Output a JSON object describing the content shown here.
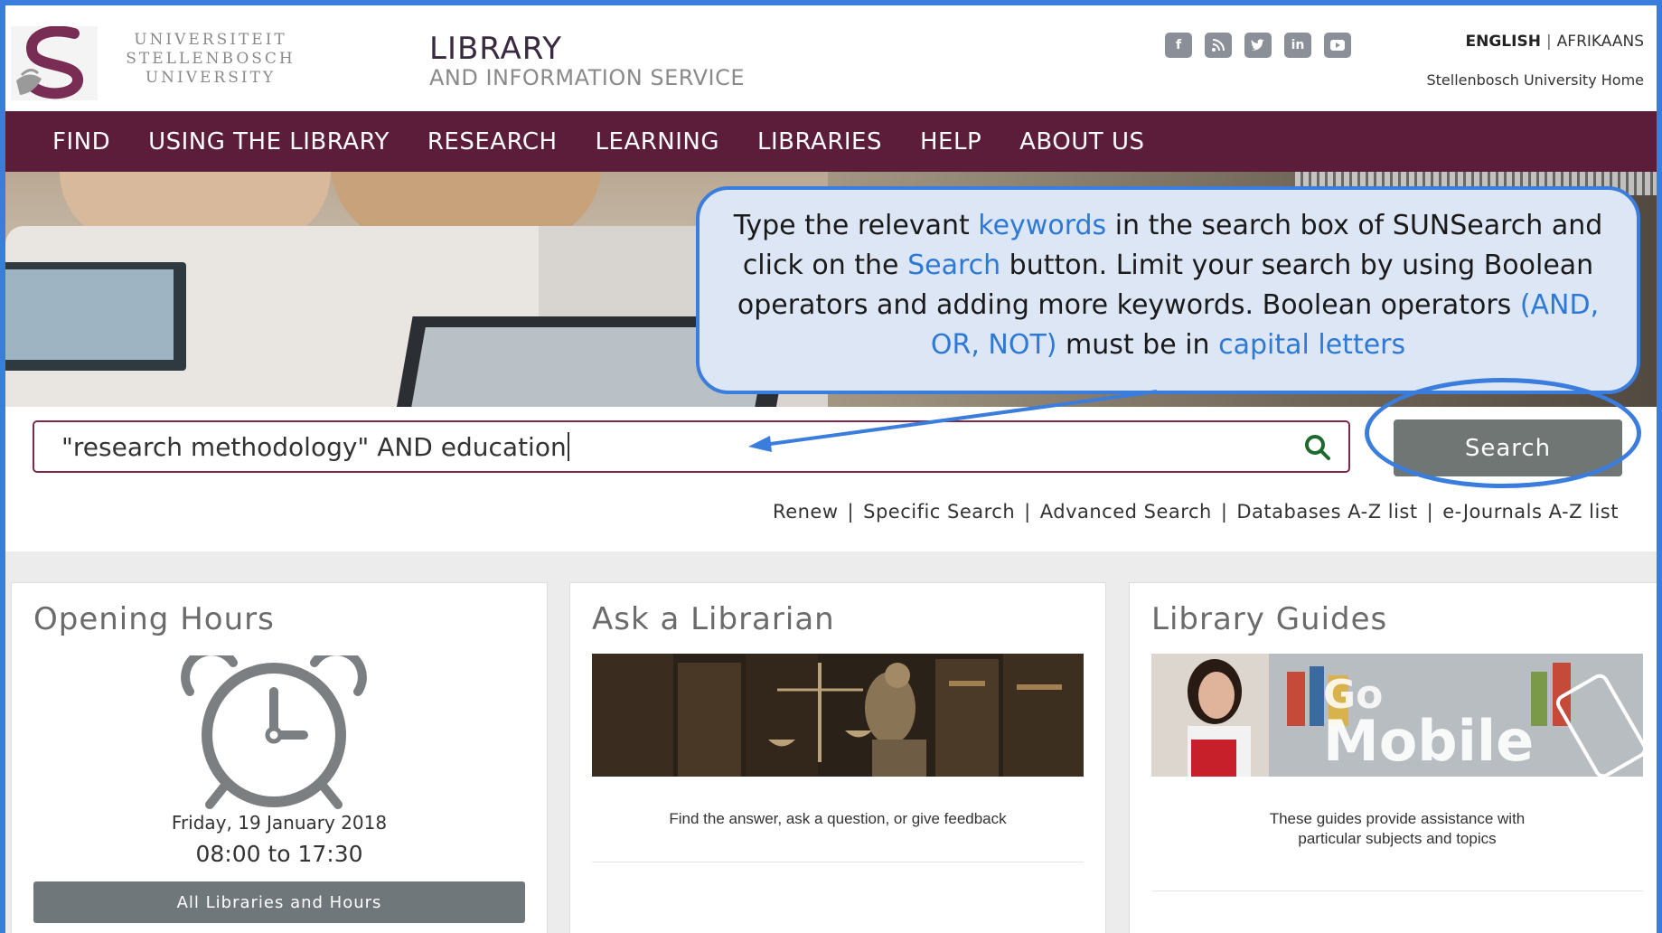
{
  "header": {
    "university_lines": [
      "UNIVERSITEIT",
      "STELLENBOSCH",
      "UNIVERSITY"
    ],
    "library_title": "LIBRARY",
    "library_subtitle": "AND INFORMATION SERVICE",
    "social_icons": [
      "facebook-icon",
      "rss-icon",
      "twitter-icon",
      "linkedin-icon",
      "youtube-icon"
    ],
    "lang_english": "ENGLISH",
    "lang_sep": "|",
    "lang_afrikaans": "AFRIKAANS",
    "home_link": "Stellenbosch University Home"
  },
  "nav": {
    "items": [
      "FIND",
      "USING THE LIBRARY",
      "RESEARCH",
      "LEARNING",
      "LIBRARIES",
      "HELP",
      "ABOUT US"
    ]
  },
  "search": {
    "value": "\"research methodology\" AND education",
    "button_label": "Search",
    "links": [
      "Renew",
      "Specific Search",
      "Advanced Search",
      "Databases A-Z list",
      "e-Journals A-Z list"
    ],
    "link_sep": "|"
  },
  "callout": {
    "parts": [
      "Type the relevant ",
      "keywords",
      " in the search box of SUNSearch and click on the  ",
      "Search",
      " button. Limit your search by using Boolean operators and adding more keywords. Boolean operators ",
      "(AND, OR, NOT)",
      "  must be in ",
      "capital letters"
    ]
  },
  "cards": {
    "opening": {
      "title": "Opening Hours",
      "date": "Friday, 19 January 2018",
      "time": "08:00 to 17:30",
      "button": "All Libraries and Hours"
    },
    "ask": {
      "title": "Ask a Librarian",
      "desc": "Find the answer, ask a question, or give feedback"
    },
    "guides": {
      "title": "Library Guides",
      "image_text_1": "Go",
      "image_text_2": "Mobile",
      "desc_1": "These guides provide assistance with",
      "desc_2": "particular subjects and topics"
    }
  },
  "colors": {
    "nav_bg": "#5c1d3b",
    "accent_blue": "#3b7ddd",
    "highlight_text": "#2d79d6",
    "button_grey": "#6f7674"
  }
}
